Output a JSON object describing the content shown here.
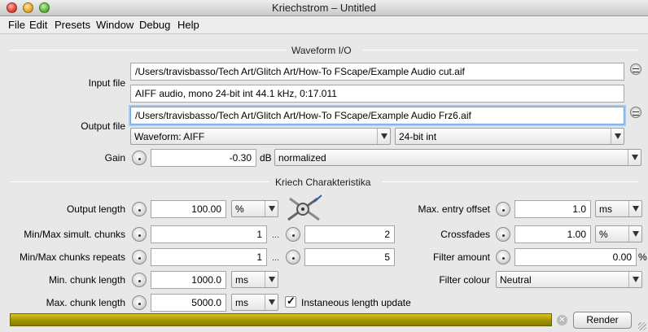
{
  "window": {
    "title": "Kriechstrom – Untitled"
  },
  "menu": [
    "File",
    "Edit",
    "Presets",
    "Window",
    "Debug",
    "Help"
  ],
  "waveform_io": {
    "section_title": "Waveform I/O",
    "input_label": "Input file",
    "input_path": "/Users/travisbasso/Tech Art/Glitch Art/How-To FScape/Example Audio cut.aif",
    "input_info": "AIFF audio, mono 24-bit int 44.1 kHz, 0:17.011",
    "output_label": "Output file",
    "output_path": "/Users/travisbasso/Tech Art/Glitch Art/How-To FScape/Example Audio Frz6.aif",
    "output_format": "Waveform: AIFF",
    "output_resolution": "24-bit int",
    "gain_label": "Gain",
    "gain_value": "-0.30",
    "gain_unit": "dB",
    "gain_mode": "normalized"
  },
  "kriech": {
    "section_title": "Kriech Charakteristika",
    "output_length_label": "Output length",
    "output_length_value": "100.00",
    "output_length_unit": "%",
    "simult_chunks_label": "Min/Max simult. chunks",
    "simult_chunks_min": "1",
    "simult_chunks_max": "2",
    "chunk_repeats_label": "Min/Max chunks repeats",
    "chunk_repeats_min": "1",
    "chunk_repeats_max": "5",
    "min_chunk_length_label": "Min. chunk length",
    "min_chunk_length_value": "1000.0",
    "min_chunk_length_unit": "ms",
    "max_chunk_length_label": "Max. chunk length",
    "max_chunk_length_value": "5000.0",
    "max_chunk_length_unit": "ms",
    "ellipsis": "...",
    "instantaneous_label": "Instaneous length update",
    "instantaneous_checked": true,
    "max_entry_offset_label": "Max. entry offset",
    "max_entry_offset_value": "1.0",
    "max_entry_offset_unit": "ms",
    "crossfades_label": "Crossfades",
    "crossfades_value": "1.00",
    "crossfades_unit": "%",
    "filter_amount_label": "Filter amount",
    "filter_amount_value": "0.00",
    "filter_amount_unit": "%",
    "filter_colour_label": "Filter colour",
    "filter_colour_value": "Neutral"
  },
  "footer": {
    "render_label": "Render",
    "progress": 1.0
  },
  "colors": {
    "progress": "#b8a600",
    "focus": "#a8c9ec"
  }
}
